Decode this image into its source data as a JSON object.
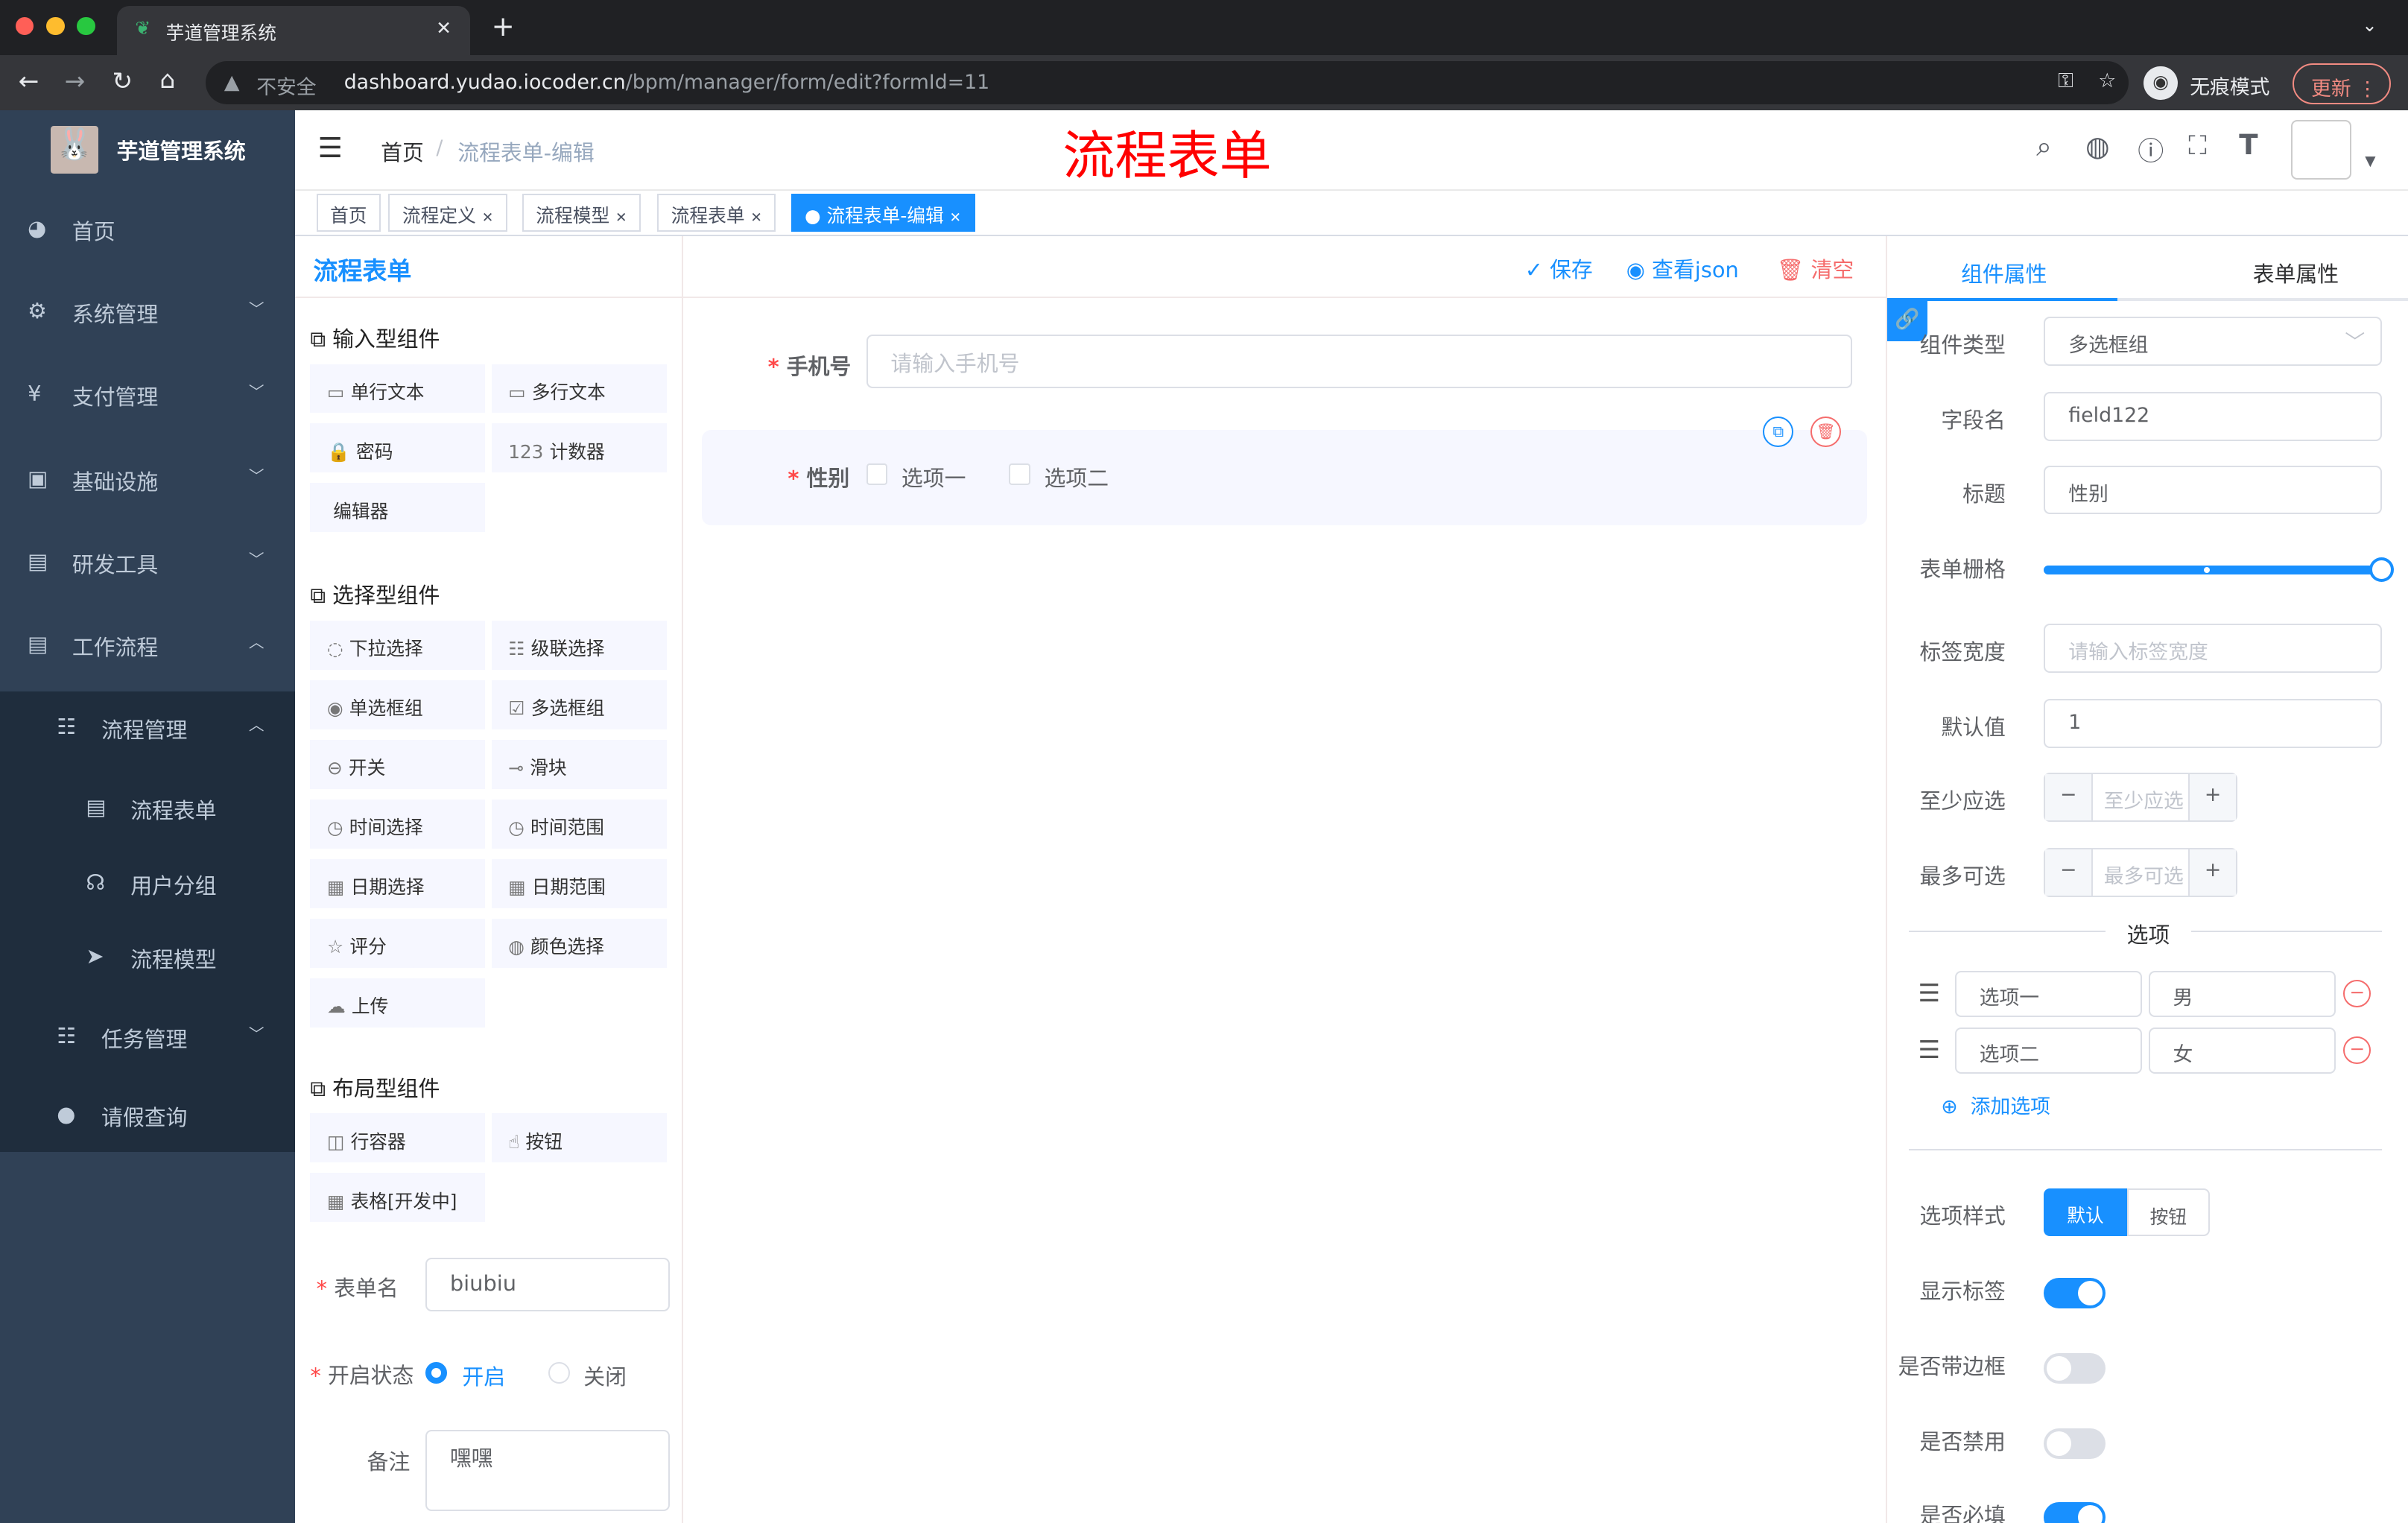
{
  "browser": {
    "tab_title": "芋道管理系统",
    "insecure": "不安全",
    "url_host": "dashboard.yudao.iocoder.cn",
    "url_path": "/bpm/manager/form/edit?formId=11",
    "incognito": "无痕模式",
    "update": "更新"
  },
  "sidebar": {
    "app_name": "芋道管理系统",
    "items": [
      {
        "label": "首页",
        "icon": "dashboard-icon"
      },
      {
        "label": "系统管理",
        "icon": "gear-icon"
      },
      {
        "label": "支付管理",
        "icon": "yen-icon"
      },
      {
        "label": "基础设施",
        "icon": "monitor-icon"
      },
      {
        "label": "研发工具",
        "icon": "toolbox-icon"
      },
      {
        "label": "工作流程",
        "icon": "toolbox-icon"
      },
      {
        "label": "流程管理",
        "icon": "tree-icon"
      },
      {
        "label": "流程表单",
        "icon": "form-icon"
      },
      {
        "label": "用户分组",
        "icon": "group-icon"
      },
      {
        "label": "流程模型",
        "icon": "send-icon"
      },
      {
        "label": "任务管理",
        "icon": "tree-icon"
      },
      {
        "label": "请假查询",
        "icon": "user-icon"
      }
    ]
  },
  "header": {
    "breadcrumb_home": "首页",
    "breadcrumb_current": "流程表单-编辑",
    "overlay_title": "流程表单"
  },
  "tags": [
    {
      "label": "首页"
    },
    {
      "label": "流程定义"
    },
    {
      "label": "流程模型"
    },
    {
      "label": "流程表单"
    },
    {
      "label": "流程表单-编辑"
    }
  ],
  "palette": {
    "title": "流程表单",
    "groups": [
      {
        "title": "输入型组件",
        "items": [
          "单行文本",
          "多行文本",
          "密码",
          "计数器",
          "编辑器"
        ]
      },
      {
        "title": "选择型组件",
        "items": [
          "下拉选择",
          "级联选择",
          "单选框组",
          "多选框组",
          "开关",
          "滑块",
          "时间选择",
          "时间范围",
          "日期选择",
          "日期范围",
          "评分",
          "颜色选择",
          "上传"
        ]
      },
      {
        "title": "布局型组件",
        "items": [
          "行容器",
          "按钮",
          "表格[开发中]"
        ]
      }
    ],
    "form_name_label": "表单名",
    "form_name": "biubiu",
    "status_label": "开启状态",
    "status_on": "开启",
    "status_off": "关闭",
    "remark_label": "备注",
    "remark": "嘿嘿"
  },
  "toolbar": {
    "save": "保存",
    "view_json": "查看json",
    "clear": "清空"
  },
  "canvas": {
    "phone_label": "手机号",
    "phone_placeholder": "请输入手机号",
    "gender_label": "性别",
    "options": [
      "选项一",
      "选项二"
    ]
  },
  "props": {
    "tab_component": "组件属性",
    "tab_form": "表单属性",
    "type_label": "组件类型",
    "type_value": "多选框组",
    "field_label": "字段名",
    "field_value": "field122",
    "title_label": "标题",
    "title_value": "性别",
    "grid_label": "表单栅格",
    "grid_value": 24,
    "grid_max": 24,
    "label_width_label": "标签宽度",
    "label_width_placeholder": "请输入标签宽度",
    "default_label": "默认值",
    "default_value": "1",
    "min_label": "至少应选",
    "min_placeholder": "至少应选",
    "max_label": "最多可选",
    "max_placeholder": "最多可选",
    "options_divider": "选项",
    "options": [
      {
        "label": "选项一",
        "value": "男"
      },
      {
        "label": "选项二",
        "value": "女"
      }
    ],
    "add_option": "添加选项",
    "style_label": "选项样式",
    "style_default": "默认",
    "style_button": "按钮",
    "show_label": "显示标签",
    "show_label_on": true,
    "border_label": "是否带边框",
    "border_on": false,
    "disabled_label": "是否禁用",
    "disabled_on": false,
    "required_label": "是否必填",
    "required_on": true
  },
  "colors": {
    "accent": "#1890ff",
    "sidebar": "#304156",
    "danger": "#f56c6c",
    "title_red": "#ff0000"
  }
}
